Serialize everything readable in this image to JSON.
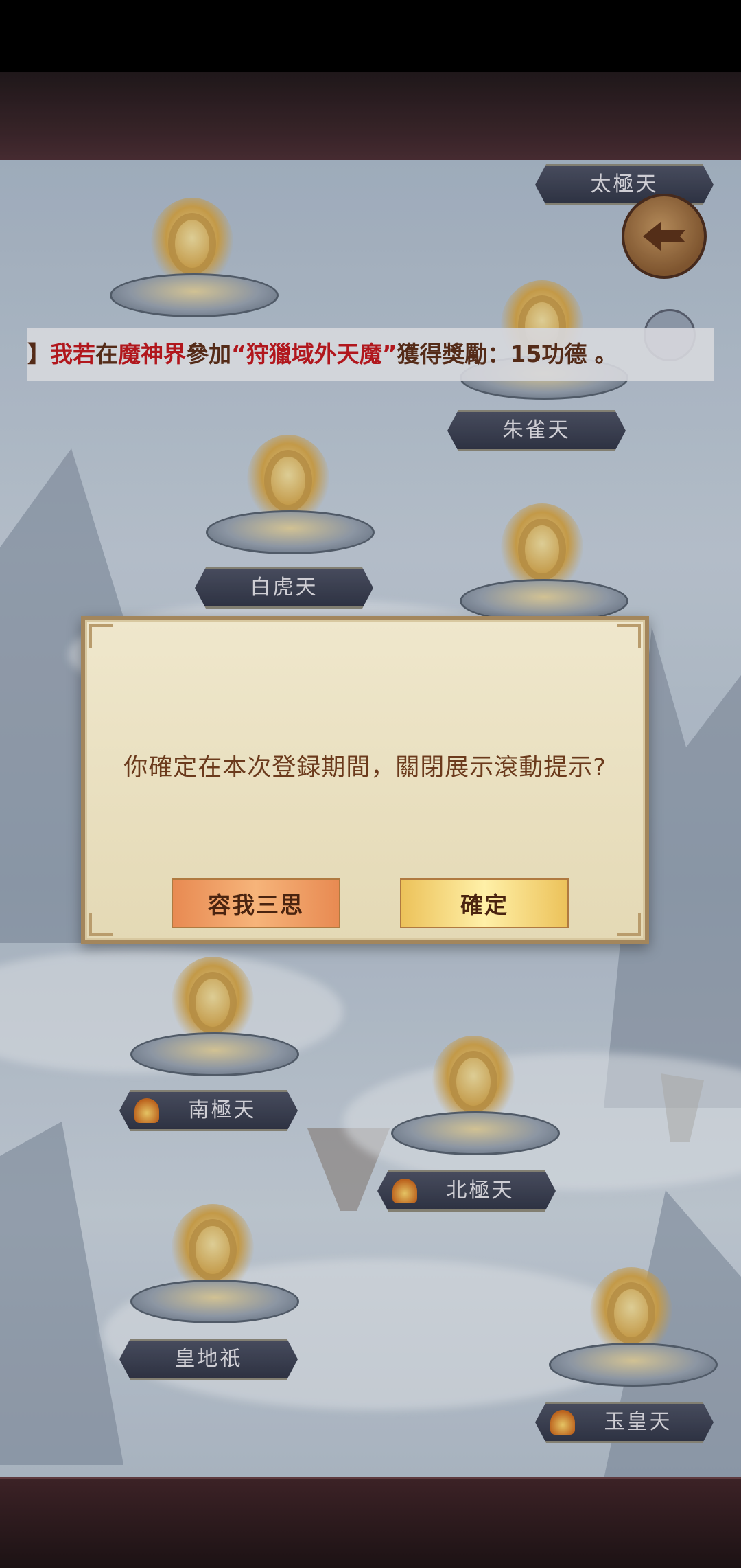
{
  "map": {
    "realms": [
      {
        "name": "太極天",
        "has_icon": false
      },
      {
        "name": "朱雀天",
        "has_icon": false
      },
      {
        "name": "白虎天",
        "has_icon": false
      },
      {
        "name": "南極天",
        "has_icon": true
      },
      {
        "name": "北極天",
        "has_icon": true
      },
      {
        "name": "皇地祇",
        "has_icon": false
      },
      {
        "name": "玉皇天",
        "has_icon": true
      }
    ]
  },
  "ticker": {
    "prefix": "】",
    "player": "我若",
    "text1": "在",
    "place": "魔神界",
    "text2": "參加",
    "event": "“狩獵域外天魔”",
    "text3": "獲得獎勵：15功德 。"
  },
  "dialog": {
    "message": "你確定在本次登録期間，關閉展示滾動提示?",
    "cancel_label": "容我三思",
    "confirm_label": "確定"
  },
  "colors": {
    "highlight_red": "#c4141a",
    "dialog_text": "#6b3a1c",
    "cancel_button": "#e88a52",
    "confirm_button": "#ecc25a"
  }
}
